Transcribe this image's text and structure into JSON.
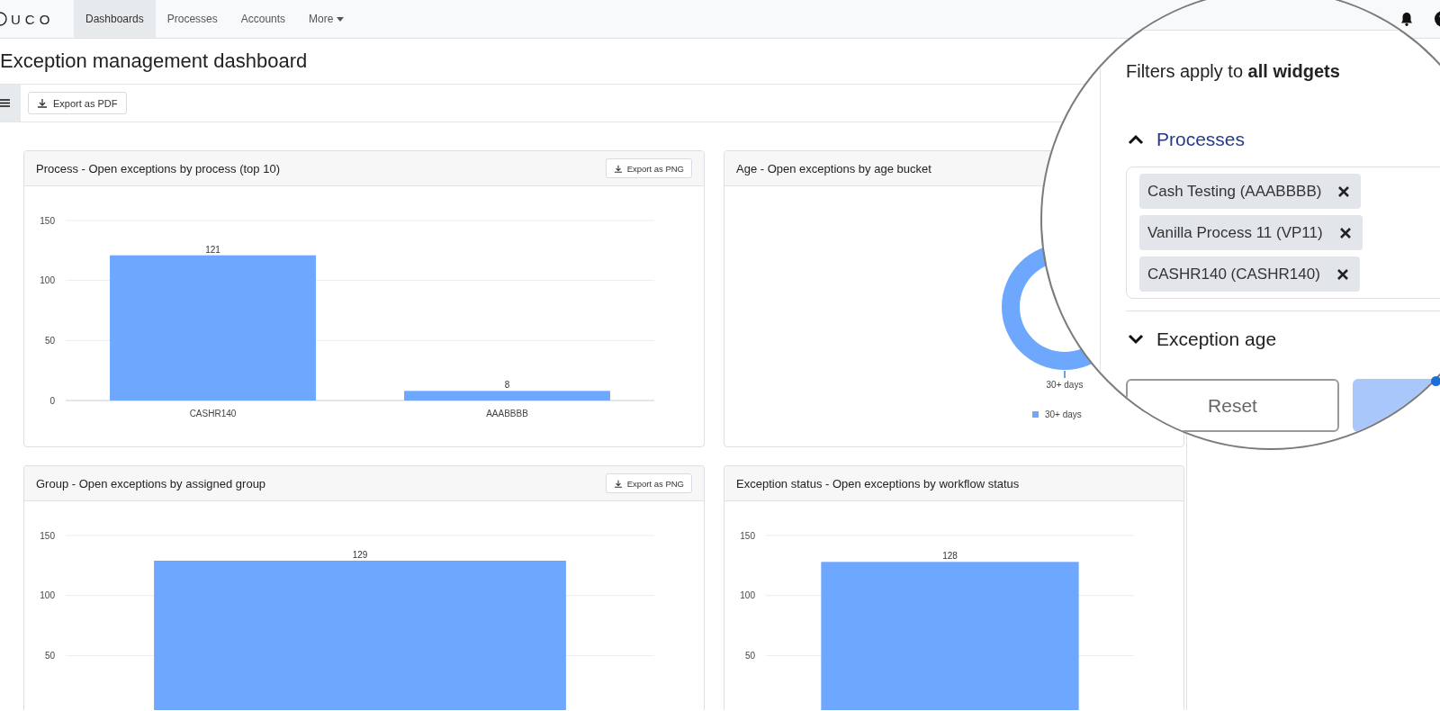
{
  "nav": {
    "logo": "UCO",
    "items": [
      {
        "label": "Dashboards",
        "selected": true,
        "kind": "link"
      },
      {
        "label": "Processes",
        "selected": false,
        "kind": "link"
      },
      {
        "label": "Accounts",
        "selected": false,
        "kind": "link"
      },
      {
        "label": "More",
        "selected": false,
        "kind": "dropdown"
      }
    ]
  },
  "page_title": "Exception management dashboard",
  "toolbar": {
    "export_button": "Export as PDF"
  },
  "widgets": [
    {
      "kind": "bar",
      "title": "Process - Open exceptions by process (top 10)",
      "export_button": "Export as PNG",
      "chart_data": {
        "type": "bar",
        "categories": [
          "CASHR140",
          "AAABBBB"
        ],
        "series": [
          {
            "color": "#6ea8fe",
            "values": [
              121,
              8
            ]
          }
        ],
        "ylim": [
          0,
          150
        ],
        "yticks": [
          0,
          50,
          100,
          150
        ],
        "data_labels": true
      }
    },
    {
      "kind": "donut",
      "title": "Age - Open exceptions by age bucket",
      "slice_label": "30+ days",
      "legend": [
        {
          "label": "30+ days",
          "color": "#6ea8fe"
        }
      ]
    },
    {
      "kind": "bar",
      "title": "Group - Open exceptions by assigned group",
      "export_button": "Export as PNG",
      "chart_data": {
        "type": "bar",
        "series": [
          {
            "color": "#6ea8fe",
            "values": [
              129
            ]
          }
        ],
        "ylim": [
          0,
          150
        ],
        "yticks": [
          50,
          100,
          150
        ],
        "data_labels": true
      }
    },
    {
      "kind": "bar",
      "title": "Exception status - Open exceptions by workflow status",
      "chart_data": {
        "type": "bar",
        "series": [
          {
            "color": "#6ea8fe",
            "values": [
              128
            ]
          }
        ],
        "ylim": [
          0,
          150
        ],
        "yticks": [
          50,
          100,
          150
        ],
        "data_labels": true
      }
    }
  ],
  "filter_panel": {
    "heading": "Filters apply to **all widgets**",
    "sections": [
      {
        "label": "Processes",
        "expanded": true,
        "chips": [
          "Cash Testing (AAABBBB)",
          "Vanilla Process 11 (VP11)",
          "CASHR140 (CASHR140)"
        ]
      },
      {
        "label": "Exception age",
        "expanded": false
      }
    ],
    "reset_button": "Reset"
  }
}
